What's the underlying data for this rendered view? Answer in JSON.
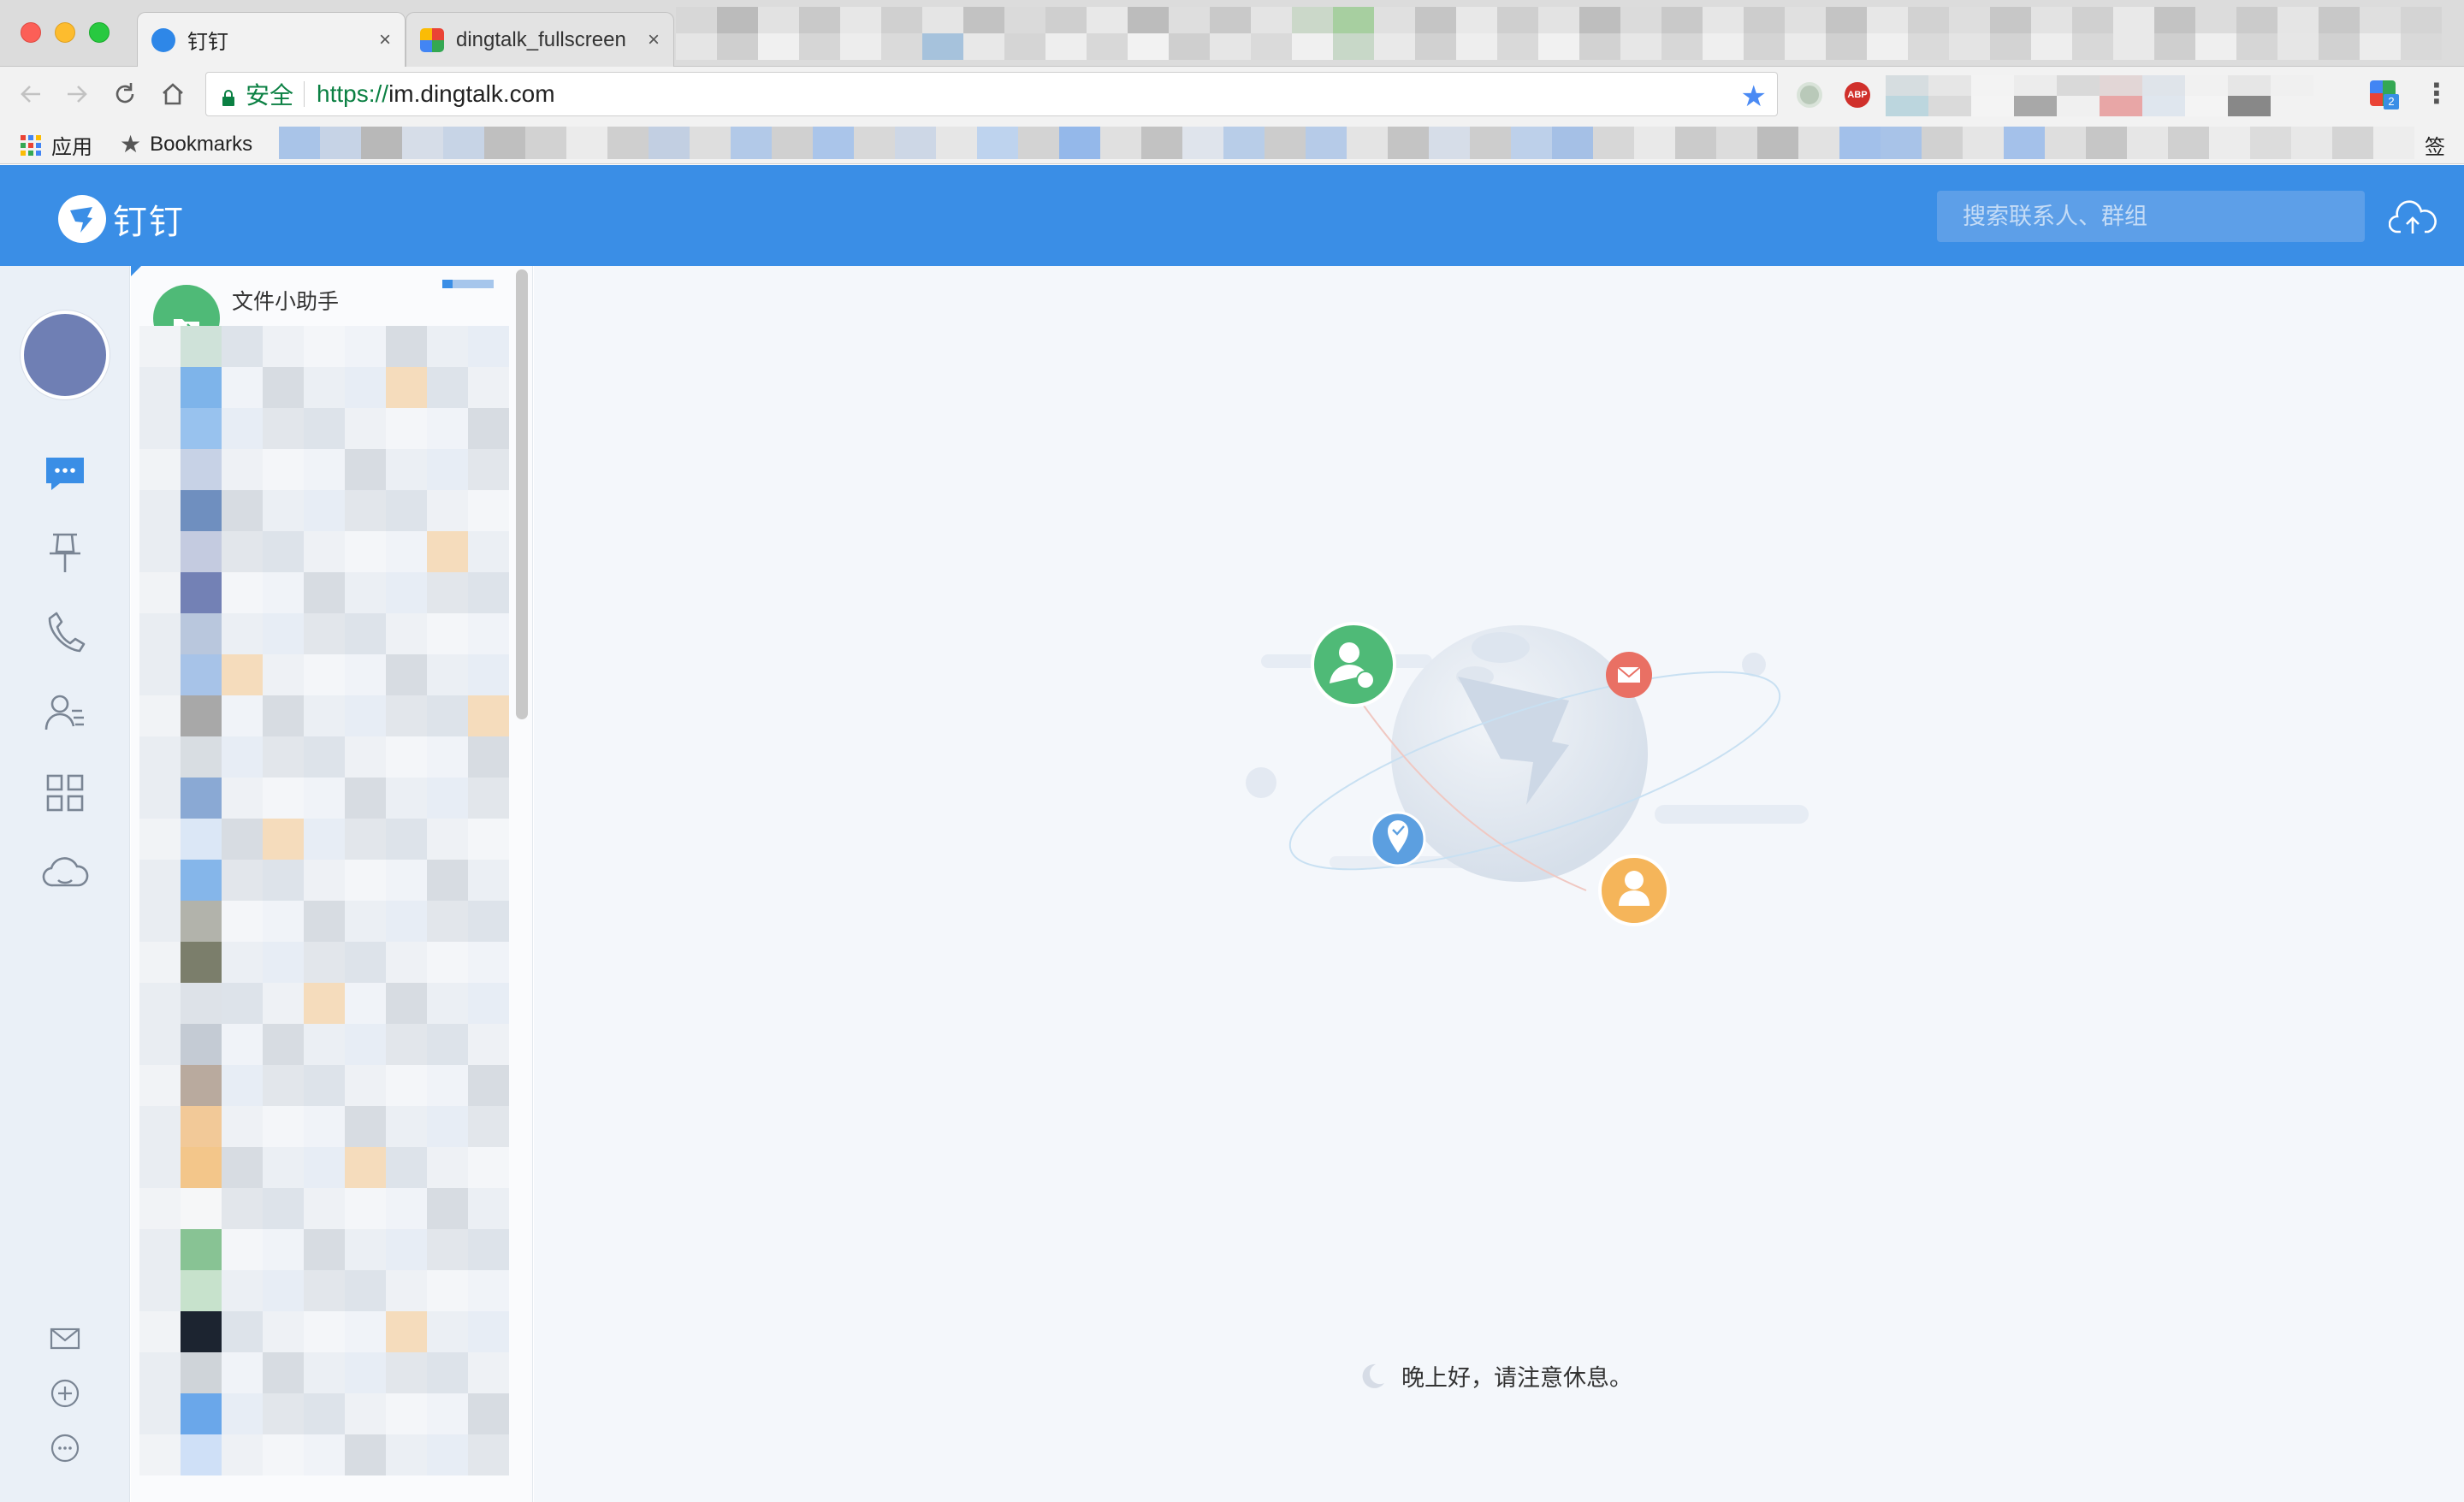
{
  "browser": {
    "tabs": [
      {
        "title": "钉钉",
        "active": true,
        "close": "×"
      },
      {
        "title": "dingtalk_fullscreen",
        "active": false,
        "close": "×"
      }
    ],
    "address": {
      "secure_label": "安全",
      "scheme": "https://",
      "host": "im.dingtalk.com"
    },
    "extensions": [
      "green-circle-extension",
      "adblock-plus-extension",
      "sync-extension"
    ],
    "extension_labels": {
      "abp": "ABP",
      "sync_badge": "2"
    },
    "menu_icon": "⋮",
    "bookmarks": {
      "apps_label": "应用",
      "bookmarks_label": "Bookmarks",
      "overflow_label": "签"
    }
  },
  "app": {
    "brand_name": "钉钉",
    "search_placeholder": "搜索联系人、群组",
    "accent_color": "#3a8ee6",
    "rail_icons": [
      "chat-icon",
      "pin-icon",
      "phone-icon",
      "contacts-icon",
      "apps-grid-icon",
      "cloud-icon"
    ],
    "rail_bottom_icons": [
      "mail-icon",
      "add-circle-icon",
      "more-circle-icon"
    ],
    "conversations": {
      "pinned_item_name": "文件小助手"
    },
    "greeting": "晚上好，请注意休息。"
  }
}
